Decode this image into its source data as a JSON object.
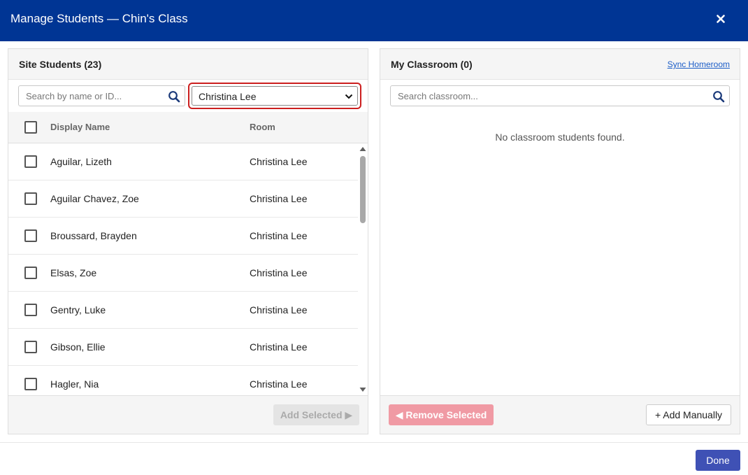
{
  "dialog": {
    "title": "Manage Students — Chin's Class",
    "close_label": "×"
  },
  "site_panel": {
    "title": "Site Students (23)",
    "search_placeholder": "Search by name or ID...",
    "room_filter_value": "Christina Lee",
    "columns": {
      "name": "Display Name",
      "room": "Room"
    },
    "rows": [
      {
        "name": "Aguilar, Lizeth",
        "room": "Christina Lee"
      },
      {
        "name": "Aguilar Chavez, Zoe",
        "room": "Christina Lee"
      },
      {
        "name": "Broussard, Brayden",
        "room": "Christina Lee"
      },
      {
        "name": "Elsas, Zoe",
        "room": "Christina Lee"
      },
      {
        "name": "Gentry, Luke",
        "room": "Christina Lee"
      },
      {
        "name": "Gibson, Ellie",
        "room": "Christina Lee"
      },
      {
        "name": "Hagler, Nia",
        "room": "Christina Lee"
      }
    ],
    "add_selected_label": "Add Selected ▶"
  },
  "classroom_panel": {
    "title": "My Classroom (0)",
    "sync_label": "Sync Homeroom",
    "search_placeholder": "Search classroom...",
    "empty_message": "No classroom students found.",
    "remove_selected_label": "◀ Remove Selected",
    "add_manually_label": "+ Add Manually"
  },
  "footer": {
    "done_label": "Done"
  },
  "colors": {
    "header": "#003594",
    "select_highlight": "#cc1f1f",
    "done_button": "#3f51b5",
    "remove_button": "#f09aa4",
    "link": "#1a5cc7"
  },
  "icons": {
    "close": "close-icon",
    "search": "search-icon",
    "dropdown": "chevron-down-icon"
  }
}
